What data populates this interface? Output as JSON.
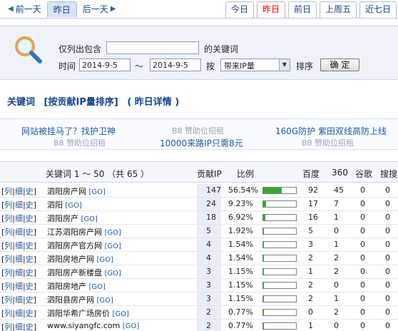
{
  "nav": {
    "prev_day": "前一天",
    "yesterday": "昨日",
    "next_day": "后一天"
  },
  "tabs": [
    "今日",
    "昨日",
    "前日",
    "上周五",
    "近七日"
  ],
  "active_tab": "昨日",
  "search": {
    "contains_label": "仅列出包含",
    "keyword_suffix": "的关键词",
    "keyword_value": "",
    "time_label": "时间",
    "date_from": "2014-9-5",
    "date_sep": "～",
    "date_to": "2014-9-5",
    "by_label": "按",
    "sort_select": "带来IP量",
    "sort_label": "排序",
    "confirm": "确 定"
  },
  "section": {
    "keyword": "关键词",
    "sort_by": "[按贡献IP量排序]",
    "detail": "( 昨日详情 )"
  },
  "sponsors": {
    "ad1": "网站被挂马了？找护卫神",
    "ad2": "B8 赞助位招租",
    "ad3": "160G防护 紫田双线高防上线",
    "ad4": "B8 赞助位招租",
    "ad5": "10000来路IP只需8元",
    "ad6": "B8 赞助位招租"
  },
  "table": {
    "headers": {
      "keyword": "关键词 1 ～ 50 （共 65 ）",
      "ip": "贡献IP",
      "ratio": "比例",
      "baidu": "百度",
      "s360": "360",
      "google": "谷歌",
      "sogou": "搜搜"
    },
    "link_labels": [
      "列",
      "细",
      "史"
    ],
    "go_label": "[GO]",
    "rows": [
      {
        "keyword": "泗阳房产网",
        "ip": "147",
        "ratio": "56.54%",
        "pct": 56.54,
        "baidu": "92",
        "s360": "45",
        "google": "0",
        "sogou": "0"
      },
      {
        "keyword": "泗阳",
        "ip": "24",
        "ratio": "9.23%",
        "pct": 9.23,
        "baidu": "17",
        "s360": "7",
        "google": "0",
        "sogou": "0"
      },
      {
        "keyword": "泗阳房产",
        "ip": "18",
        "ratio": "6.92%",
        "pct": 6.92,
        "baidu": "16",
        "s360": "1",
        "google": "0",
        "sogou": "0"
      },
      {
        "keyword": "江苏泗阳房产网",
        "ip": "5",
        "ratio": "1.92%",
        "pct": 1.92,
        "baidu": "5",
        "s360": "0",
        "google": "0",
        "sogou": "0"
      },
      {
        "keyword": "泗阳房产官方网",
        "ip": "4",
        "ratio": "1.54%",
        "pct": 1.54,
        "baidu": "3",
        "s360": "1",
        "google": "0",
        "sogou": "0"
      },
      {
        "keyword": "泗阳房地产网",
        "ip": "4",
        "ratio": "1.54%",
        "pct": 1.54,
        "baidu": "2",
        "s360": "2",
        "google": "0",
        "sogou": "0"
      },
      {
        "keyword": "泗阳房产新楼盘",
        "ip": "3",
        "ratio": "1.15%",
        "pct": 1.15,
        "baidu": "1",
        "s360": "2",
        "google": "0",
        "sogou": "0"
      },
      {
        "keyword": "泗阳房地产",
        "ip": "3",
        "ratio": "1.15%",
        "pct": 1.15,
        "baidu": "2",
        "s360": "0",
        "google": "0",
        "sogou": "0"
      },
      {
        "keyword": "泗阳县房产网",
        "ip": "3",
        "ratio": "1.15%",
        "pct": 1.15,
        "baidu": "2",
        "s360": "1",
        "google": "0",
        "sogou": "0"
      },
      {
        "keyword": "泗阳华希广场房价",
        "ip": "2",
        "ratio": "0.77%",
        "pct": 0.77,
        "baidu": "0",
        "s360": "2",
        "google": "0",
        "sogou": "0"
      },
      {
        "keyword": "www.siyangfc.com",
        "ip": "2",
        "ratio": "0.77%",
        "pct": 0.77,
        "baidu": "1",
        "s360": "0",
        "google": "0",
        "sogou": "0"
      }
    ]
  },
  "colors": {
    "link": "#1f57a6",
    "active_tab_text": "#dd0000",
    "bar_fill": "#3aa33a",
    "panel_bg": "#eef3fa"
  }
}
